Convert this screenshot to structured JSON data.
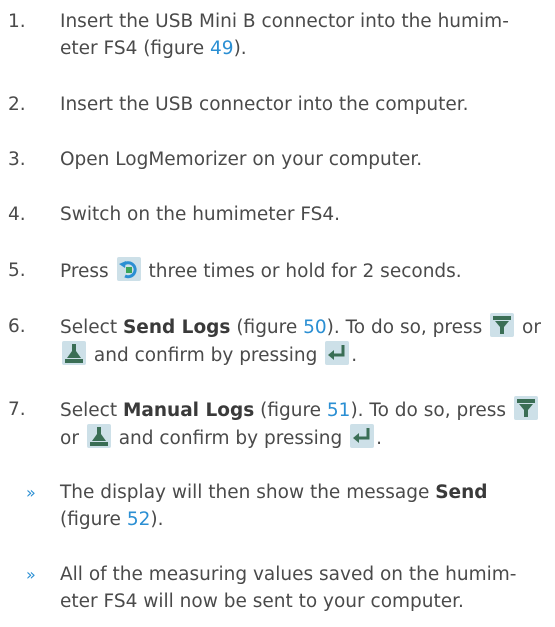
{
  "steps": [
    {
      "num": "1.",
      "pre": "Insert the USB Mini B connector into the humim-",
      "line2_pre": "eter FS4 (figure ",
      "link": "49",
      "line2_post": ")."
    },
    {
      "num": "2.",
      "text": "Insert the USB connector into the computer."
    },
    {
      "num": "3.",
      "text": "Open LogMemorizer on your computer."
    },
    {
      "num": "4.",
      "text": "Switch on the humimeter FS4."
    },
    {
      "num": "5.",
      "pre": "Press ",
      "post": " three times or hold for 2 seconds."
    },
    {
      "num": "6.",
      "pre": "Select ",
      "bold": "Send Logs",
      "mid": " (figure ",
      "link": "50",
      "post": "). To do so, press ",
      "or": " or",
      "line2_post": " and confirm by pressing ",
      "end": "."
    },
    {
      "num": "7.",
      "pre": "Select ",
      "bold": "Manual Logs",
      "mid": " (figure ",
      "link": "51",
      "post": "). To do so, press ",
      "line2_pre": "or ",
      "line2_post": " and confirm by pressing ",
      "end": "."
    }
  ],
  "bullets": [
    {
      "symbol": "»",
      "pre": "The display will then show the message ",
      "bold": "Send",
      "line2_pre": "(figure ",
      "link": "52",
      "line2_post": ")."
    },
    {
      "symbol": "»",
      "line1": "All of the measuring values saved on the humim-",
      "line2": "eter FS4 will now be sent to your computer."
    }
  ],
  "icons": {
    "mode": "rotate-arrow-icon",
    "down": "down-arrow-icon",
    "up": "up-arrow-icon",
    "enter": "enter-icon"
  },
  "colors": {
    "text": "#4a4a4a",
    "link": "#2b8fd3",
    "icon_bg": "#cde0e8"
  }
}
